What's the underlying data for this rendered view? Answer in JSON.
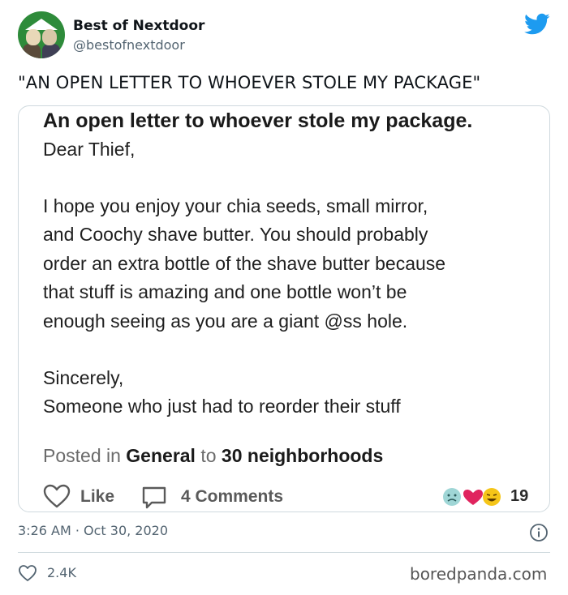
{
  "author": {
    "display_name": "Best of Nextdoor",
    "handle": "@bestofnextdoor"
  },
  "tweet_text": "\"AN OPEN LETTER TO WHOEVER STOLE MY PACKAGE\"",
  "card": {
    "title": "An open letter to whoever stole my package.",
    "lines": [
      "Dear Thief,",
      "I hope you enjoy your chia seeds, small mirror,",
      "and Coochy shave butter. You should probably",
      "order an extra bottle of the shave butter because",
      "that stuff is amazing and one bottle won’t be",
      "enough seeing as you are a giant @ss hole.",
      "Sincerely,",
      "Someone who just had to reorder their stuff"
    ],
    "posted_prefix": "Posted in",
    "posted_category": "General",
    "posted_to": "to",
    "posted_audience": "30 neighborhoods",
    "like_label": "Like",
    "comments_label": "4 Comments",
    "reaction_count": "19"
  },
  "timestamp": "3:26 AM · Oct 30, 2020",
  "like_count": "2.4K",
  "watermark": "boredpanda.com",
  "colors": {
    "twitter_blue": "#1d9bf0",
    "nextdoor_green": "#2e8b3a"
  }
}
